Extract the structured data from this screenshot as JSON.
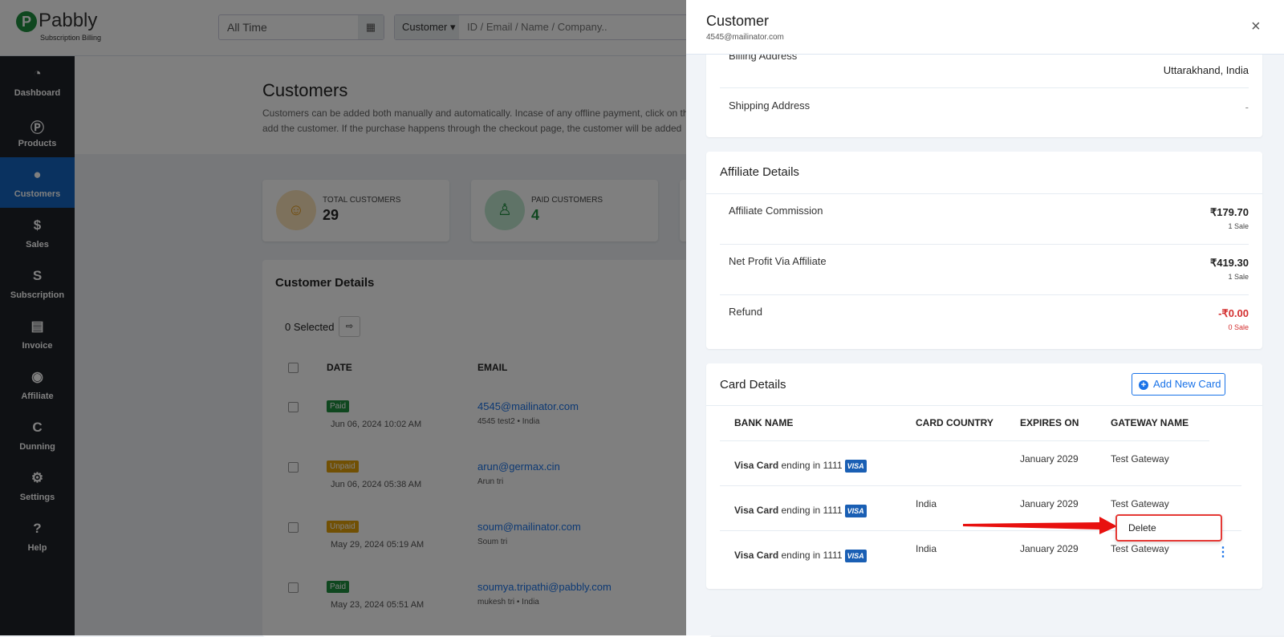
{
  "brand": {
    "name": "Pabbly",
    "sub": "Subscription Billing",
    "accent": "#1565c0"
  },
  "filters": {
    "date": "All Time",
    "search_type": "Customer",
    "search_placeholder": "ID / Email / Name / Company.."
  },
  "sidebar": {
    "items": [
      {
        "label": "Dashboard",
        "icon": "gauge-icon"
      },
      {
        "label": "Products",
        "icon": "p-circle-icon"
      },
      {
        "label": "Customers",
        "icon": "user-icon",
        "active": true
      },
      {
        "label": "Sales",
        "icon": "hand-dollar-icon"
      },
      {
        "label": "Subscription",
        "icon": "s-icon"
      },
      {
        "label": "Invoice",
        "icon": "file-icon"
      },
      {
        "label": "Affiliate",
        "icon": "broadcast-icon"
      },
      {
        "label": "Dunning",
        "icon": "refresh-icon"
      },
      {
        "label": "Settings",
        "icon": "gear-icon"
      },
      {
        "label": "Help",
        "icon": "help-icon"
      }
    ]
  },
  "page": {
    "title": "Customers",
    "description_1": "Customers can be added both manually and automatically. Incase of any offline payment, click on th",
    "description_2": "add the customer. If the purchase happens through the checkout page, the customer will be added"
  },
  "stats": [
    {
      "label": "TOTAL CUSTOMERS",
      "value": "29"
    },
    {
      "label": "PAID CUSTOMERS",
      "value": "4"
    }
  ],
  "customers": {
    "title": "Customer Details",
    "selected": "0 Selected",
    "columns": [
      "DATE",
      "EMAIL"
    ],
    "rows": [
      {
        "status": "Paid",
        "date": "Jun 06, 2024 10:02 AM",
        "email": "4545@mailinator.com",
        "sub": "4545 test2 • India"
      },
      {
        "status": "Unpaid",
        "date": "Jun 06, 2024 05:38 AM",
        "email": "arun@germax.cin",
        "sub": "Arun tri"
      },
      {
        "status": "Unpaid",
        "date": "May 29, 2024 05:19 AM",
        "email": "soum@mailinator.com",
        "sub": "Soum tri"
      },
      {
        "status": "Paid",
        "date": "May 23, 2024 05:51 AM",
        "email": "soumya.tripathi@pabbly.com",
        "sub": "mukesh tri • India"
      }
    ]
  },
  "panel": {
    "title": "Customer",
    "email": "4545@mailinator.com",
    "close": "×",
    "address": {
      "billing_label": "Billing Address",
      "billing_value": "Uttarakhand, India",
      "shipping_label": "Shipping Address",
      "shipping_value": "-"
    },
    "affiliate": {
      "title": "Affiliate Details",
      "rows": [
        {
          "label": "Affiliate Commission",
          "value": "₹179.70",
          "sub": "1 Sale"
        },
        {
          "label": "Net Profit Via Affiliate",
          "value": "₹419.30",
          "sub": "1 Sale"
        },
        {
          "label": "Refund",
          "value": "-₹0.00",
          "sub": "0 Sale"
        }
      ]
    },
    "cards": {
      "title": "Card Details",
      "add_label": "Add New Card",
      "columns": [
        "BANK NAME",
        "CARD COUNTRY",
        "EXPIRES ON",
        "GATEWAY NAME"
      ],
      "rows": [
        {
          "brand": "Visa Card",
          "ending": "ending in 1111",
          "logo": "VISA",
          "country": "",
          "expires": "January 2029",
          "gateway": "Test Gateway"
        },
        {
          "brand": "Visa Card",
          "ending": "ending in 1111",
          "logo": "VISA",
          "country": "India",
          "expires": "January 2029",
          "gateway": "Test Gateway"
        },
        {
          "brand": "Visa Card",
          "ending": "ending in 1111",
          "logo": "VISA",
          "country": "India",
          "expires": "January 2029",
          "gateway": "Test Gateway"
        }
      ],
      "menu": {
        "delete": "Delete"
      }
    }
  }
}
